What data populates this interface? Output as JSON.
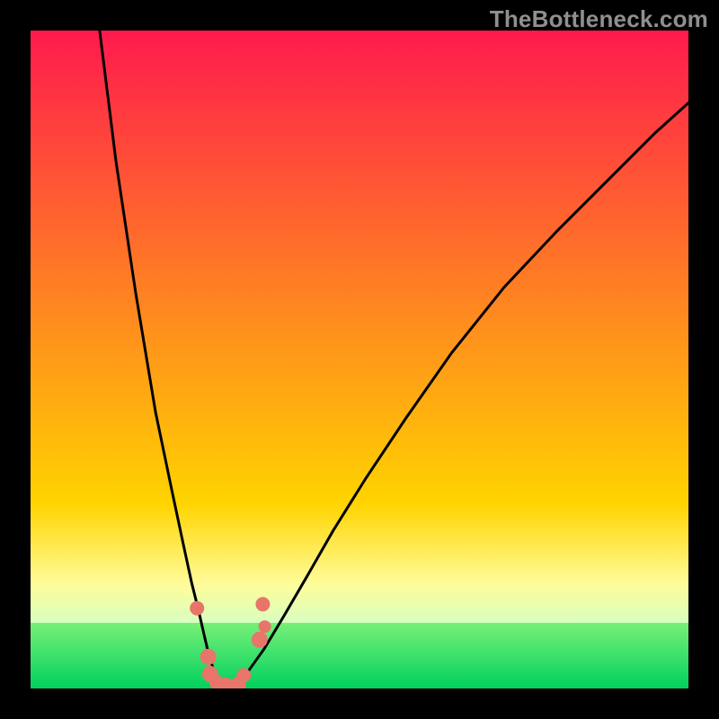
{
  "watermark": "TheBottleneck.com",
  "chart_data": {
    "type": "line",
    "title": "",
    "xlabel": "",
    "ylabel": "",
    "xlim": [
      0,
      100
    ],
    "ylim": [
      0,
      100
    ],
    "gradient_bands": [
      {
        "from": 0,
        "to": 72,
        "top": "#ff1a4d",
        "bottom": "#ffd400"
      },
      {
        "from": 72,
        "to": 84,
        "top": "#ffd400",
        "bottom": "#fffc99"
      },
      {
        "from": 84,
        "to": 90,
        "top": "#fffc99",
        "bottom": "#d8ffc0"
      },
      {
        "from": 90,
        "to": 100,
        "top": "#78f078",
        "bottom": "#00d15e"
      }
    ],
    "series": [
      {
        "name": "left-branch",
        "x": [
          10.5,
          13,
          16,
          19,
          21.5,
          23.2,
          24.5,
          25.5,
          26.3,
          27.0,
          27.6,
          28.1,
          28.8,
          29.6
        ],
        "y": [
          100,
          80,
          60,
          42,
          30,
          22,
          16,
          12,
          8.5,
          5.5,
          3.5,
          1.8,
          0.6,
          0.0
        ]
      },
      {
        "name": "right-branch",
        "x": [
          29.6,
          31.0,
          33.0,
          35.5,
          38.5,
          42.0,
          46.0,
          51.0,
          57.0,
          64.0,
          72.0,
          80.0,
          88.0,
          95.0,
          100.0
        ],
        "y": [
          0.0,
          0.5,
          2.5,
          6.0,
          11.0,
          17.0,
          24.0,
          32.0,
          41.0,
          51.0,
          61.0,
          69.5,
          77.5,
          84.5,
          89.0
        ]
      }
    ],
    "scatter": {
      "name": "highlighted-points",
      "color": "#e8756a",
      "points": [
        {
          "x": 25.3,
          "y": 12.2,
          "r": 8
        },
        {
          "x": 27.0,
          "y": 4.8,
          "r": 9
        },
        {
          "x": 27.3,
          "y": 2.2,
          "r": 9
        },
        {
          "x": 28.2,
          "y": 1.0,
          "r": 8
        },
        {
          "x": 29.6,
          "y": 0.3,
          "r": 10
        },
        {
          "x": 31.5,
          "y": 0.5,
          "r": 9
        },
        {
          "x": 32.4,
          "y": 2.0,
          "r": 8
        },
        {
          "x": 34.8,
          "y": 7.4,
          "r": 9
        },
        {
          "x": 35.6,
          "y": 9.4,
          "r": 7
        },
        {
          "x": 35.3,
          "y": 12.8,
          "r": 8
        }
      ]
    }
  }
}
